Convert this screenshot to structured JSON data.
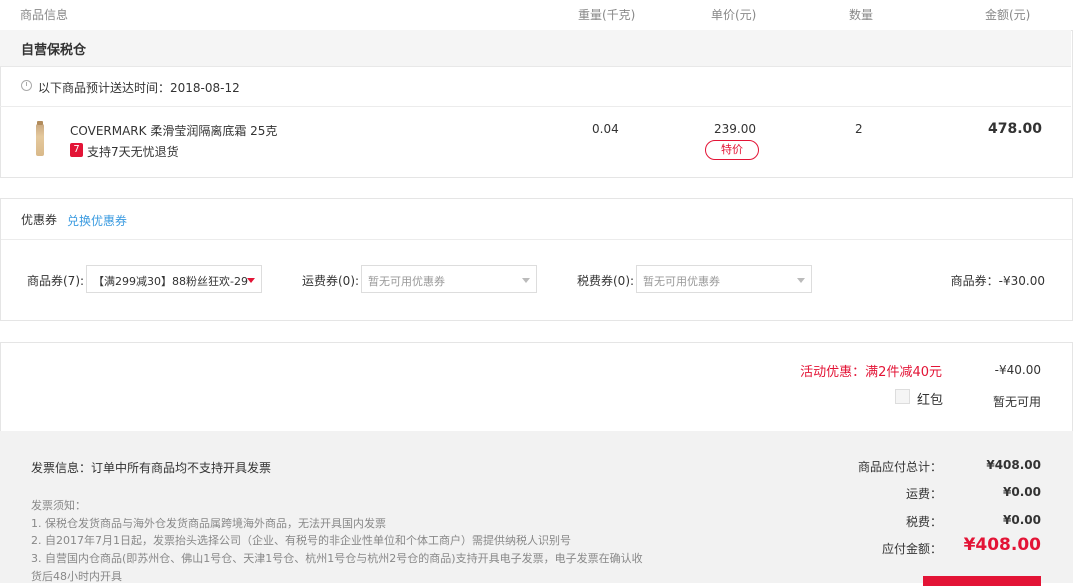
{
  "header": {
    "col_info": "商品信息",
    "col_weight": "重量(千克)",
    "col_price": "单价(元)",
    "col_qty": "数量",
    "col_amount": "金额(元)"
  },
  "warehouse": {
    "title": "自营保税仓",
    "delivery_prefix": "以下商品预计送达时间：",
    "delivery_date": "2018-08-12"
  },
  "item": {
    "name": "COVERMARK 柔滑莹润隔离底霜 25克",
    "return_badge": "7",
    "return_text": "支持7天无忧退货",
    "weight": "0.04",
    "price": "239.00",
    "price_tag": "特价",
    "qty": "2",
    "amount": "478.00"
  },
  "coupon": {
    "title": "优惠券",
    "exchange_link": "兑换优惠券",
    "goods_label": "商品券(7):",
    "goods_selected": "【满299减30】88粉丝狂欢-29...",
    "shipping_label": "运费券(0):",
    "shipping_placeholder": "暂无可用优惠券",
    "tax_label": "税费券(0):",
    "tax_placeholder": "暂无可用优惠券",
    "summary": "商品券：-¥30.00"
  },
  "promo": {
    "activity_text": "活动优惠：满2件减40元",
    "activity_amount": "-¥40.00",
    "redpacket_label": "红包",
    "redpacket_status": "暂无可用"
  },
  "invoice": {
    "info": "发票信息：订单中所有商品均不支持开具发票",
    "notice_title": "发票须知：",
    "notice_1": "1. 保税仓发货商品与海外仓发货商品属跨境海外商品，无法开具国内发票",
    "notice_2": "2. 自2017年7月1日起，发票抬头选择公司（企业、有税号的非企业性单位和个体工商户）需提供纳税人识别号",
    "notice_3a": "3. 自营国内仓商品(即苏州仓、佛山1号仓、天津1号仓、杭州1号仓与杭州2号仓的商品)支持开具电子发票，电子发票在确认收",
    "notice_3b": "货后48小时内开具"
  },
  "totals": {
    "goods_label": "商品应付总计：",
    "goods_value": "¥408.00",
    "shipping_label": "运费：",
    "shipping_value": "¥0.00",
    "tax_label": "税费：",
    "tax_value": "¥0.00",
    "payable_label": "应付金额：",
    "payable_value": "¥408.00"
  },
  "colors": {
    "accent": "#e31436",
    "link": "#3b9be0"
  }
}
